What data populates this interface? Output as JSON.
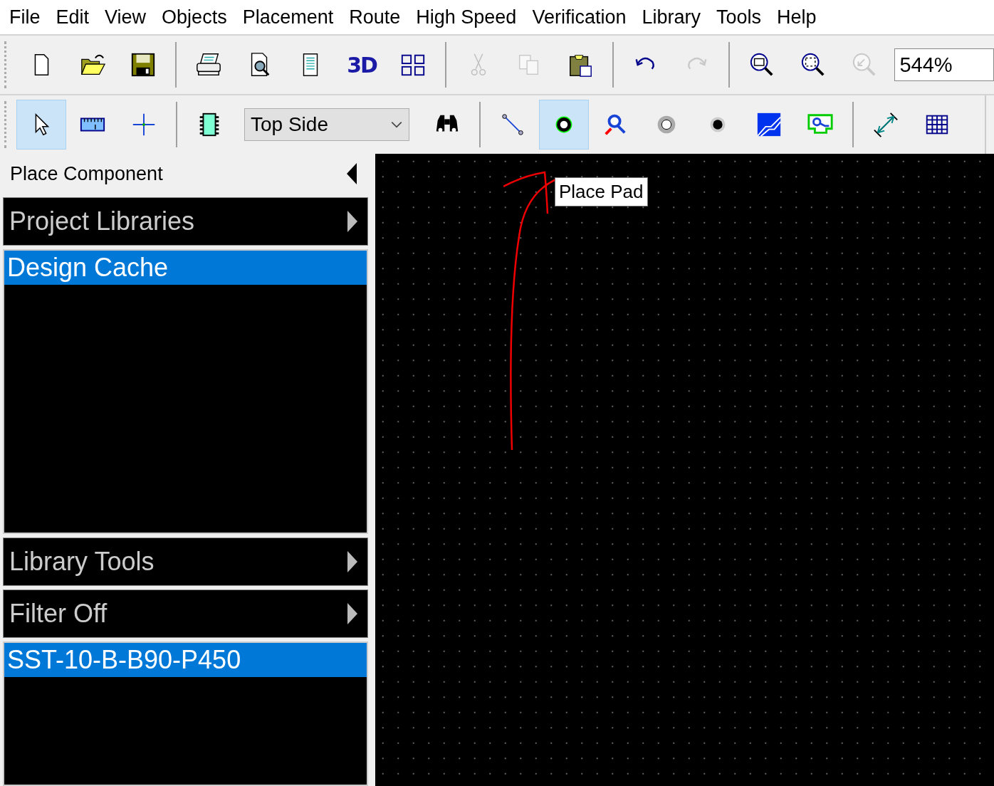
{
  "menu": [
    "File",
    "Edit",
    "View",
    "Objects",
    "Placement",
    "Route",
    "High Speed",
    "Verification",
    "Library",
    "Tools",
    "Help"
  ],
  "toolbar_main": [
    {
      "kind": "new",
      "disabled": false
    },
    {
      "kind": "open",
      "disabled": false
    },
    {
      "kind": "save",
      "disabled": false
    },
    {
      "kind": "separator"
    },
    {
      "kind": "print",
      "disabled": false
    },
    {
      "kind": "preview",
      "disabled": false
    },
    {
      "kind": "report",
      "disabled": false
    },
    {
      "kind": "view3d",
      "label": "3D",
      "disabled": false
    },
    {
      "kind": "grid",
      "disabled": false
    },
    {
      "kind": "separator"
    },
    {
      "kind": "cut",
      "disabled": true
    },
    {
      "kind": "copy",
      "disabled": true
    },
    {
      "kind": "paste",
      "disabled": false
    },
    {
      "kind": "separator"
    },
    {
      "kind": "undo",
      "disabled": false
    },
    {
      "kind": "redo",
      "disabled": true
    },
    {
      "kind": "separator"
    },
    {
      "kind": "zoomwindow",
      "disabled": false
    },
    {
      "kind": "zoomfit",
      "disabled": false
    },
    {
      "kind": "zoomprevious",
      "disabled": true
    },
    {
      "kind": "field",
      "value": "544%"
    }
  ],
  "toolbar_place": [
    {
      "kind": "pointer",
      "selected": true
    },
    {
      "kind": "measure",
      "selected": false
    },
    {
      "kind": "crosshair",
      "selected": false
    },
    {
      "kind": "separator"
    },
    {
      "kind": "component",
      "selected": false
    },
    {
      "kind": "dropdown",
      "value": "Top Side"
    },
    {
      "kind": "find",
      "selected": false
    },
    {
      "kind": "separator"
    },
    {
      "kind": "trace",
      "selected": false
    },
    {
      "kind": "pad",
      "selected": true
    },
    {
      "kind": "probe",
      "selected": false
    },
    {
      "kind": "via",
      "selected": false
    },
    {
      "kind": "dot",
      "selected": false
    },
    {
      "kind": "plane",
      "selected": false
    },
    {
      "kind": "area",
      "selected": false
    },
    {
      "kind": "separator"
    },
    {
      "kind": "dimension",
      "selected": false
    },
    {
      "kind": "table",
      "selected": false
    }
  ],
  "tooltip": "Place Pad",
  "panel": {
    "title": "Place Component",
    "sections": [
      {
        "title": "Project Libraries",
        "items": [
          {
            "label": "Design Cache",
            "selected": true
          }
        ]
      },
      {
        "title": "Library Tools"
      },
      {
        "title": "Filter Off",
        "items": [
          {
            "label": "SST-10-B-B90-P450",
            "selected": true
          }
        ]
      }
    ]
  }
}
